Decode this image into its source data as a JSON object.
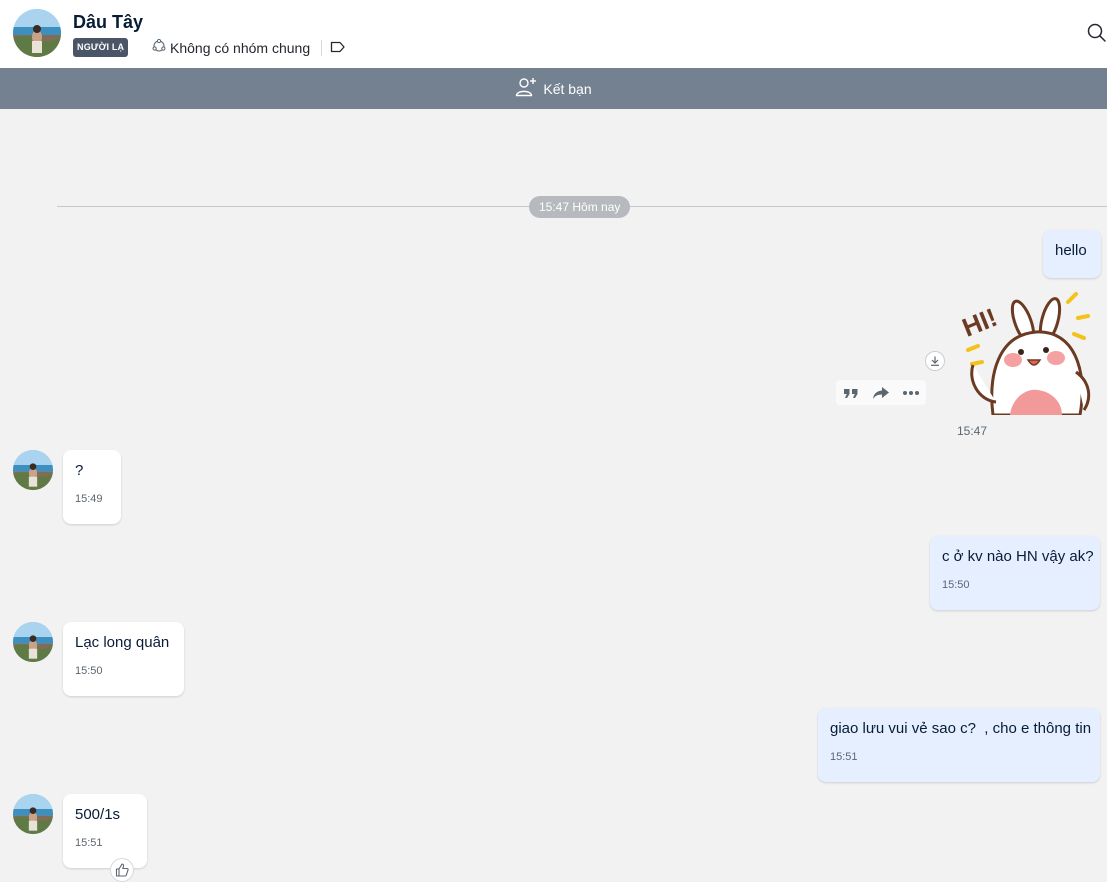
{
  "header": {
    "contact_name": "Dâu Tây",
    "stranger_badge": "NGƯỜI LẠ",
    "common_groups": "Không có nhóm chung"
  },
  "add_friend": {
    "label": "Kết bạn"
  },
  "divider": {
    "label": "15:47 Hôm nay"
  },
  "messages": [
    {
      "direction": "out",
      "text": "hello",
      "time": ""
    },
    {
      "direction": "out",
      "type": "sticker",
      "sticker_name": "HI! bunny",
      "time": "15:47"
    },
    {
      "direction": "in",
      "text": "?",
      "time": "15:49"
    },
    {
      "direction": "out",
      "text": "c ở kv nào HN vậy ak?",
      "time": "15:50"
    },
    {
      "direction": "in",
      "text": "Lạc long quân",
      "time": "15:50"
    },
    {
      "direction": "out",
      "text": "giao lưu vui vẻ sao c?  , cho e thông tin",
      "time": "15:51"
    },
    {
      "direction": "in",
      "text": "500/1s",
      "time": "15:51"
    }
  ],
  "sticker_text": "HI!",
  "icons": {
    "search": "search-icon",
    "groups": "groups-icon",
    "tag": "tag-icon",
    "add_friend": "add-user-icon",
    "quote": "quote-icon",
    "forward": "forward-icon",
    "more": "more-icon",
    "download": "download-icon",
    "like": "thumbs-up-icon"
  },
  "colors": {
    "chat_bg": "#f2f2f2",
    "outgoing_bubble": "#e5efff",
    "incoming_bubble": "#ffffff",
    "add_friend_bar": "#738190",
    "badge": "#4a5668"
  }
}
